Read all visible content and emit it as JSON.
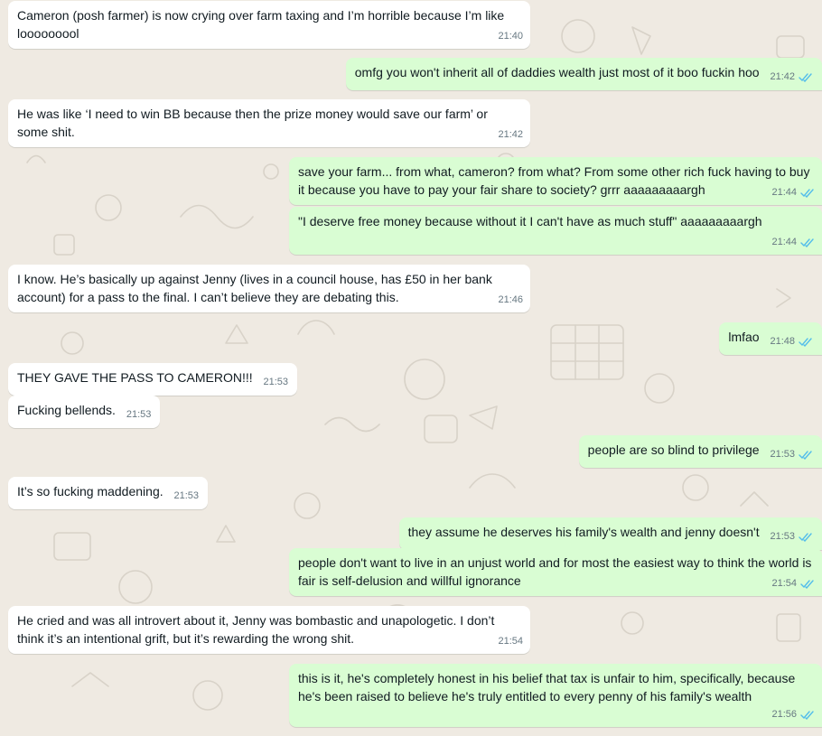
{
  "colors": {
    "chat_background": "#efeae2",
    "incoming": "#ffffff",
    "outgoing": "#d9fdd3",
    "tick": "#53bdeb",
    "meta_text": "#667781"
  },
  "messages": [
    {
      "dir": "in",
      "text": "Cameron (posh farmer) is now crying over farm taxing and I’m horrible because I’m like looooooool",
      "time": "21:40"
    },
    {
      "dir": "out",
      "text": "omfg you won't inherit all of daddies wealth just most of it boo fuckin hoo",
      "time": "21:42",
      "status": "read-ticks-icon"
    },
    {
      "dir": "in",
      "text": "He was like ‘I need to win BB because then the prize money would save our farm’ or some shit.",
      "time": "21:42"
    },
    {
      "dir": "out",
      "text": "save your farm... from what, cameron? from what? From some other rich fuck having to buy it because you have to pay your fair share to society? grrr aaaaaaaaargh",
      "time": "21:44",
      "status": "read-ticks-icon"
    },
    {
      "dir": "out",
      "text": "\"I deserve free money because without it I can't have as much stuff\" aaaaaaaaargh",
      "time": "21:44",
      "status": "read-ticks-icon"
    },
    {
      "dir": "in",
      "text": "I know. He’s basically up against Jenny (lives in a council house, has £50 in her bank account) for a pass to the final. I can’t believe they are debating this.",
      "time": "21:46"
    },
    {
      "dir": "out",
      "text": "lmfao",
      "time": "21:48",
      "status": "read-ticks-icon"
    },
    {
      "dir": "in",
      "text": "THEY GAVE THE PASS TO CAMERON!!!",
      "time": "21:53"
    },
    {
      "dir": "in",
      "text": "Fucking bellends.",
      "time": "21:53"
    },
    {
      "dir": "out",
      "text": "people are so blind to privilege",
      "time": "21:53",
      "status": "read-ticks-icon"
    },
    {
      "dir": "in",
      "text": "It’s so fucking maddening.",
      "time": "21:53"
    },
    {
      "dir": "out",
      "text": "they assume he deserves his family's wealth and jenny doesn't",
      "time": "21:53",
      "status": "read-ticks-icon"
    },
    {
      "dir": "out",
      "text": "people don't want to live in an unjust world and for most the easiest way to think the world is fair is self-delusion and willful ignorance",
      "time": "21:54",
      "status": "read-ticks-icon"
    },
    {
      "dir": "in",
      "text": "He cried and was all introvert about it, Jenny was bombastic and unapologetic. I don’t think it’s an intentional grift, but it’s rewarding the wrong shit.",
      "time": "21:54"
    },
    {
      "dir": "out",
      "text": "this is it, he's completely honest in his belief that tax is unfair to him, specifically, because he's been raised to believe he's truly entitled to every penny of his family's wealth",
      "time": "21:56",
      "status": "read-ticks-icon"
    }
  ]
}
